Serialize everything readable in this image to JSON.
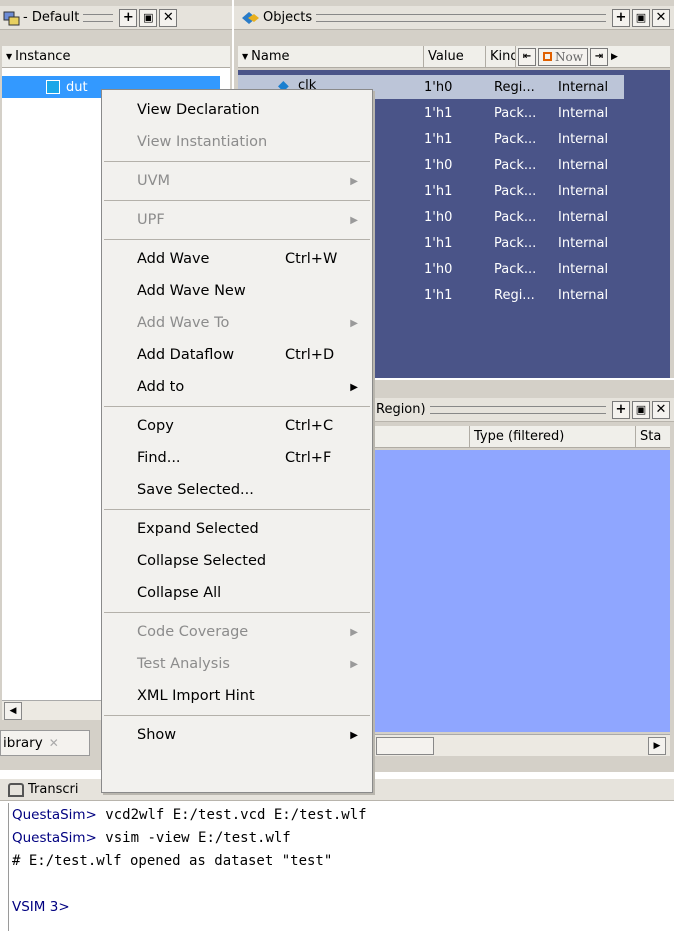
{
  "instance_pane": {
    "title": "- Default",
    "column_header": "Instance",
    "selected_item": "dut",
    "bottom_tabs": [
      "ibrary"
    ]
  },
  "objects_pane": {
    "title": "Objects",
    "columns": [
      "Name",
      "Value",
      "Kind"
    ],
    "first_name": "clk",
    "toolbar_now": "Now",
    "rows": [
      {
        "value": "1'h0",
        "kind": "Regi...",
        "mode": "Internal"
      },
      {
        "value": "1'h1",
        "kind": "Pack...",
        "mode": "Internal"
      },
      {
        "value": "1'h1",
        "kind": "Pack...",
        "mode": "Internal"
      },
      {
        "value": "1'h0",
        "kind": "Pack...",
        "mode": "Internal"
      },
      {
        "value": "1'h1",
        "kind": "Pack...",
        "mode": "Internal"
      },
      {
        "value": "1'h0",
        "kind": "Pack...",
        "mode": "Internal"
      },
      {
        "value": "1'h1",
        "kind": "Pack...",
        "mode": "Internal"
      },
      {
        "value": "1'h0",
        "kind": "Pack...",
        "mode": "Internal"
      },
      {
        "value": "1'h1",
        "kind": "Regi...",
        "mode": "Internal"
      }
    ]
  },
  "processes_pane": {
    "title": "Region)",
    "columns": [
      "Type (filtered)",
      "Sta"
    ]
  },
  "context_menu": {
    "groups": [
      [
        {
          "label": "View Declaration",
          "disabled": false
        },
        {
          "label": "View Instantiation",
          "disabled": true
        }
      ],
      [
        {
          "label": "UVM",
          "disabled": true,
          "submenu": true
        }
      ],
      [
        {
          "label": "UPF",
          "disabled": true,
          "submenu": true
        }
      ],
      [
        {
          "label": "Add Wave",
          "shortcut": "Ctrl+W",
          "disabled": false
        },
        {
          "label": "Add Wave New",
          "disabled": false
        },
        {
          "label": "Add Wave To",
          "disabled": true,
          "submenu": true
        },
        {
          "label": "Add Dataflow",
          "shortcut": "Ctrl+D",
          "disabled": false
        },
        {
          "label": "Add to",
          "disabled": false,
          "submenu": true
        }
      ],
      [
        {
          "label": "Copy",
          "shortcut": "Ctrl+C",
          "disabled": false
        },
        {
          "label": "Find...",
          "shortcut": "Ctrl+F",
          "disabled": false
        },
        {
          "label": "Save Selected...",
          "disabled": false
        }
      ],
      [
        {
          "label": "Expand Selected",
          "disabled": false
        },
        {
          "label": "Collapse Selected",
          "disabled": false
        },
        {
          "label": "Collapse All",
          "disabled": false
        }
      ],
      [
        {
          "label": "Code Coverage",
          "disabled": true,
          "submenu": true
        },
        {
          "label": "Test Analysis",
          "disabled": true,
          "submenu": true
        },
        {
          "label": "XML Import Hint",
          "disabled": false
        }
      ],
      [
        {
          "label": "Show",
          "disabled": false,
          "submenu": true
        }
      ]
    ]
  },
  "transcript": {
    "title": "Transcri",
    "lines": [
      {
        "prompt": "QuestaSim>",
        "text": " vcd2wlf E:/test.vcd E:/test.wlf"
      },
      {
        "prompt": "QuestaSim>",
        "text": " vsim -view E:/test.wlf"
      },
      {
        "prompt": "",
        "text": "# E:/test.wlf opened as dataset \"test\""
      },
      {
        "prompt": "",
        "text": ""
      },
      {
        "prompt": "VSIM 3>",
        "text": ""
      }
    ]
  },
  "colors": {
    "objects_bg": "#4a5488",
    "processes_bg": "#8fa6ff",
    "selection": "#3399ff",
    "prompt_color": "#000080"
  }
}
